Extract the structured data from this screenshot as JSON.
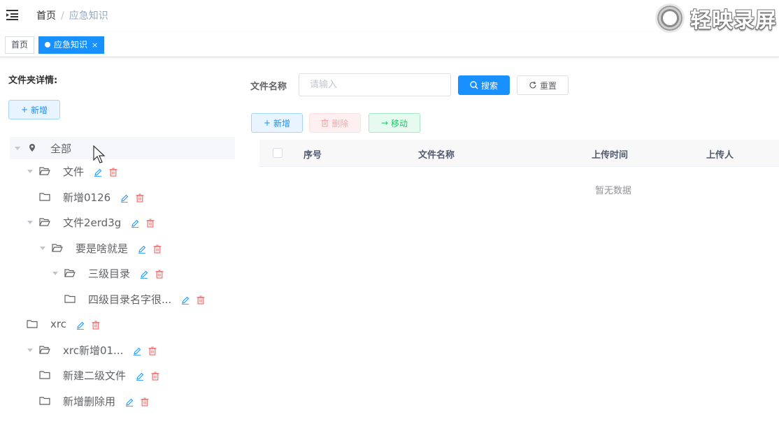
{
  "breadcrumb": {
    "home": "首页",
    "separator": "/",
    "current": "应急知识"
  },
  "watermark": "轻映录屏",
  "tags": {
    "home": "首页",
    "active": "应急知识",
    "close": "×"
  },
  "left": {
    "title": "文件夹详情:",
    "add_label": "新增"
  },
  "tree": [
    {
      "label": "全部",
      "icon": "location-icon",
      "expanded": true,
      "actions": false
    },
    {
      "label": "文件",
      "icon": "folder-open-icon",
      "expanded": true,
      "actions": true
    },
    {
      "label": "新增0126",
      "icon": "folder-icon",
      "expanded": false,
      "actions": true
    },
    {
      "label": "文件2erd3g",
      "icon": "folder-open-icon",
      "expanded": true,
      "actions": true
    },
    {
      "label": "要是啥就是",
      "icon": "folder-open-icon",
      "expanded": true,
      "actions": true
    },
    {
      "label": "三级目录",
      "icon": "folder-open-icon",
      "expanded": true,
      "actions": true
    },
    {
      "label": "四级目录名字很...",
      "icon": "folder-icon",
      "expanded": false,
      "actions": true
    },
    {
      "label": "xrc",
      "icon": "folder-icon",
      "expanded": false,
      "actions": true
    },
    {
      "label": "xrc新增01...",
      "icon": "folder-open-icon",
      "expanded": true,
      "actions": true
    },
    {
      "label": "新建二级文件",
      "icon": "folder-icon",
      "expanded": false,
      "actions": true
    },
    {
      "label": "新增删除用",
      "icon": "folder-icon",
      "expanded": false,
      "actions": true
    }
  ],
  "search": {
    "label": "文件名称",
    "placeholder": "请输入",
    "search_label": "搜索",
    "reset_label": "重置"
  },
  "toolbar": {
    "add_label": "新增",
    "delete_label": "删除",
    "move_label": "移动"
  },
  "table": {
    "columns": [
      "序号",
      "文件名称",
      "上传时间",
      "上传人"
    ],
    "empty_text": "暂无数据"
  },
  "colors": {
    "primary": "#1890ff",
    "danger": "#f56c6c",
    "success": "#13ce66"
  }
}
